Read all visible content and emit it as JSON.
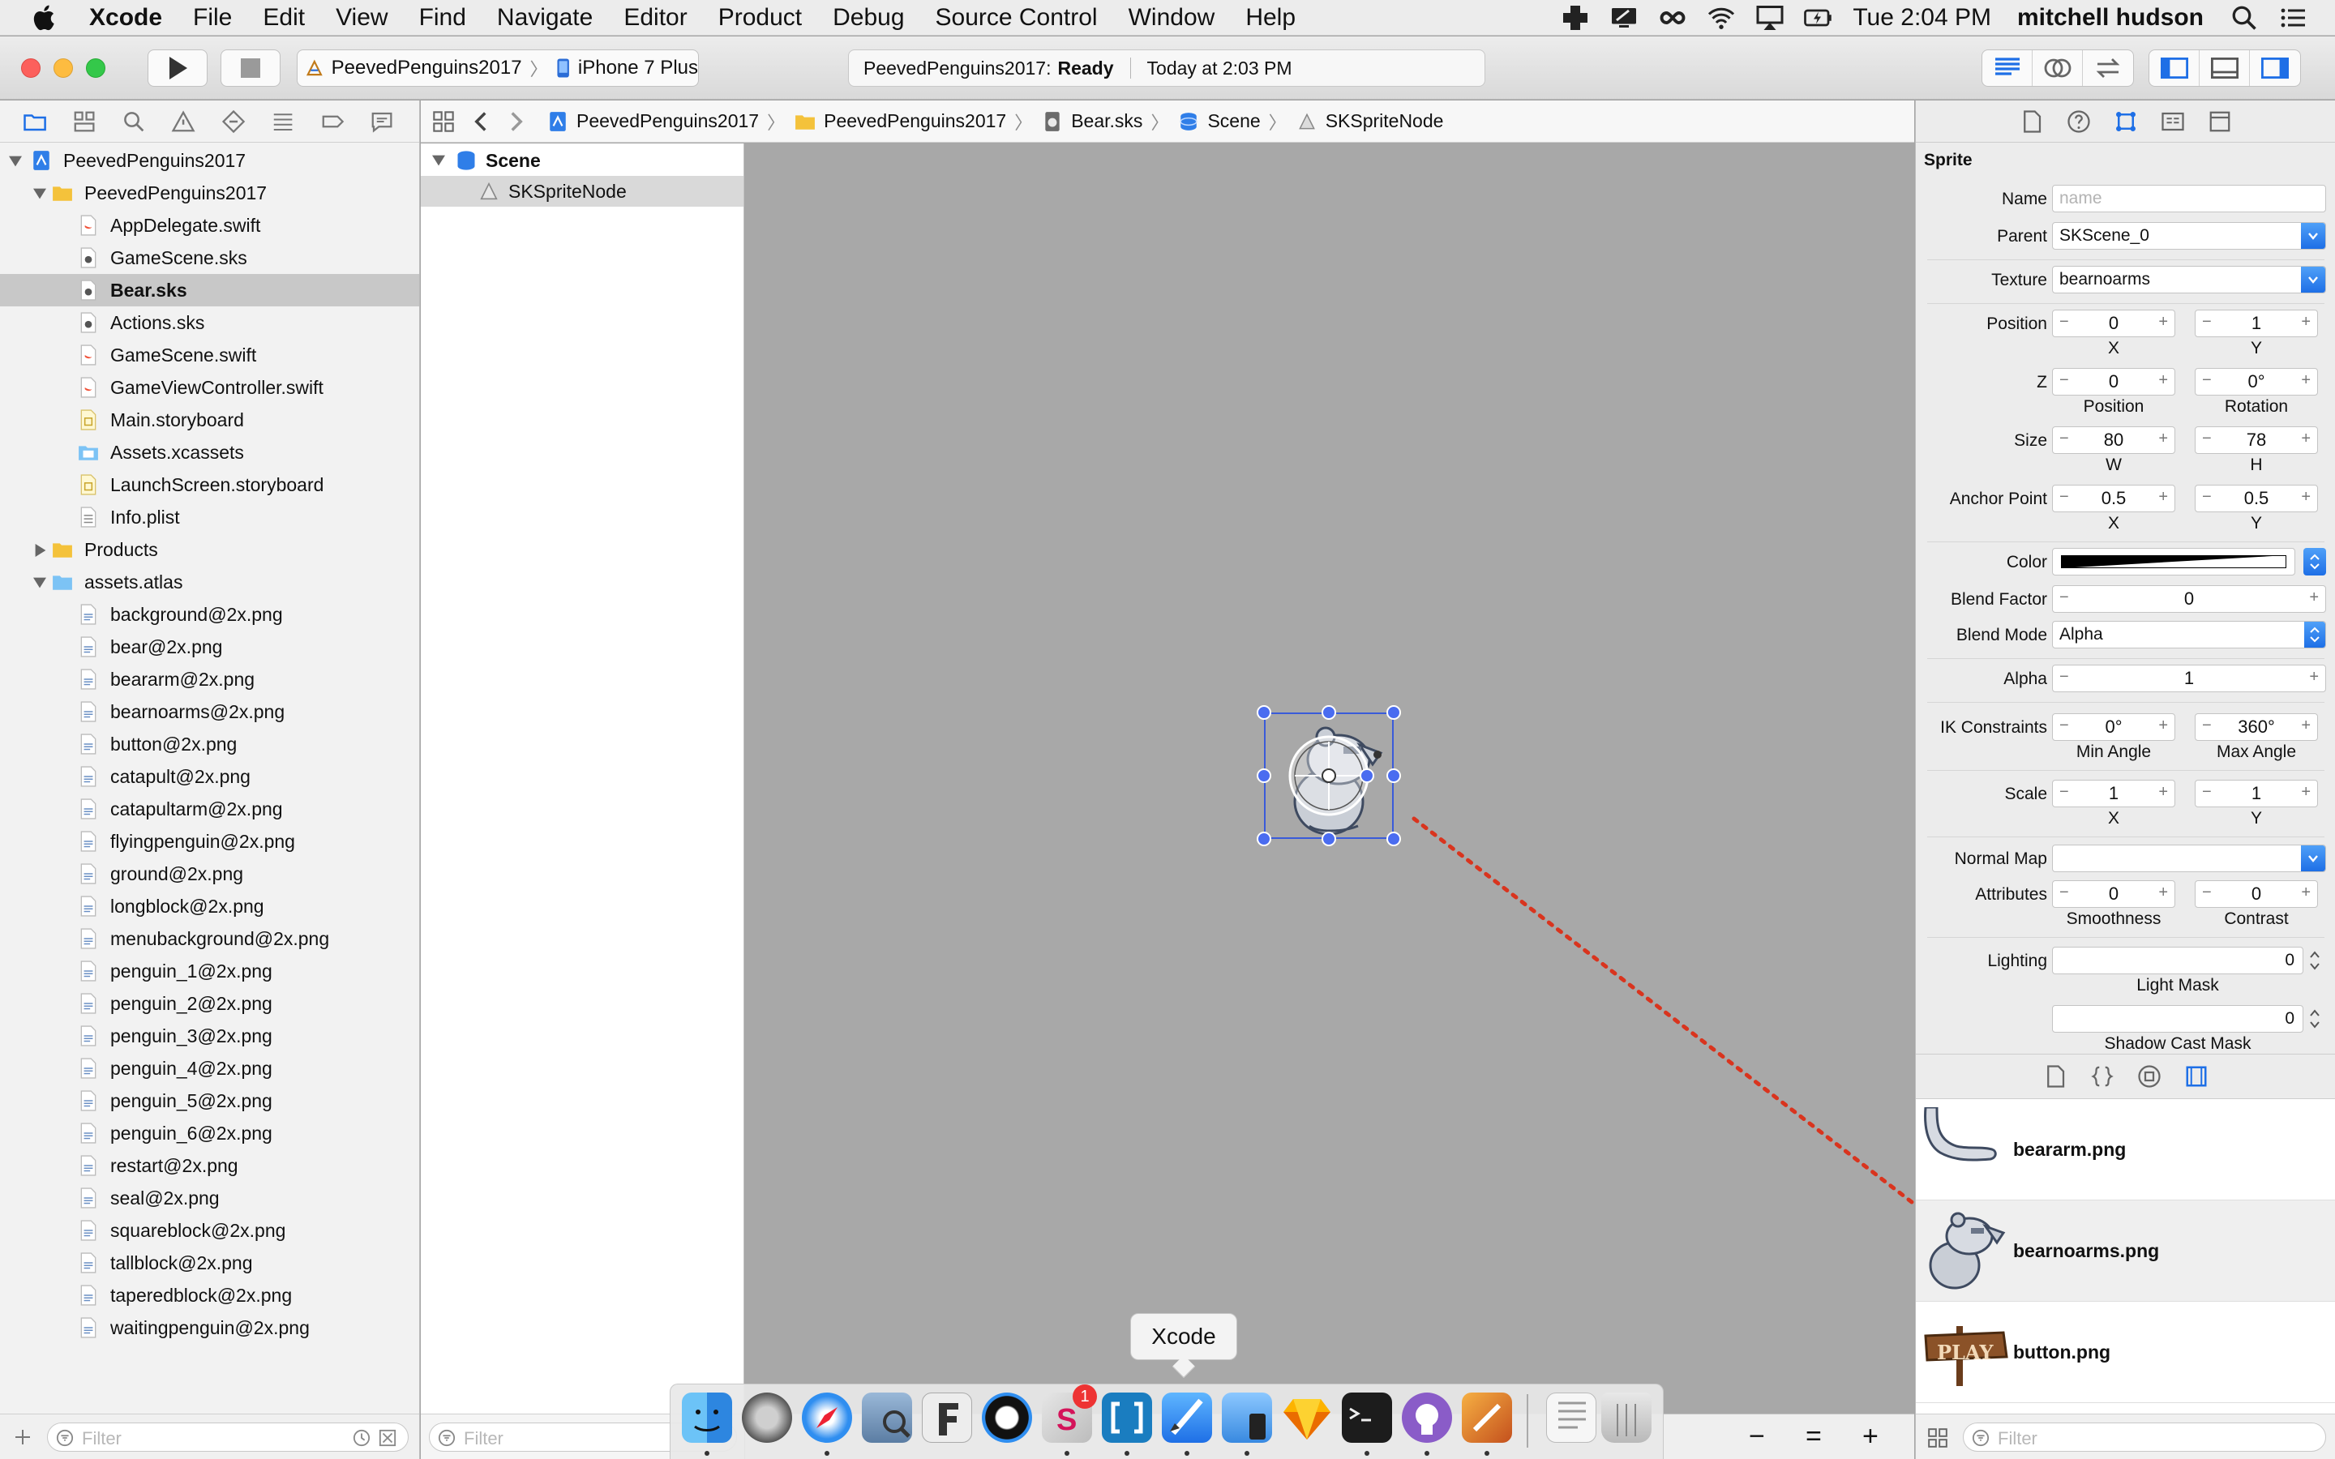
{
  "menubar": {
    "items": [
      "Xcode",
      "File",
      "Edit",
      "View",
      "Find",
      "Navigate",
      "Editor",
      "Product",
      "Debug",
      "Source Control",
      "Window",
      "Help"
    ],
    "clock": "Tue 2:04 PM",
    "user": "mitchell hudson"
  },
  "toolbar": {
    "scheme": "PeevedPenguins2017",
    "device": "iPhone 7 Plus",
    "status_project": "PeevedPenguins2017:",
    "status_state": "Ready",
    "status_time": "Today at 2:03 PM"
  },
  "navigator": {
    "rows": [
      {
        "label": "PeevedPenguins2017",
        "kind": "project",
        "indent": 0,
        "disclosure": "open"
      },
      {
        "label": "PeevedPenguins2017",
        "kind": "folder",
        "indent": 1,
        "disclosure": "open"
      },
      {
        "label": "AppDelegate.swift",
        "kind": "swift",
        "indent": 2
      },
      {
        "label": "GameScene.sks",
        "kind": "sks",
        "indent": 2
      },
      {
        "label": "Bear.sks",
        "kind": "sks",
        "indent": 2,
        "selected": true
      },
      {
        "label": "Actions.sks",
        "kind": "sks",
        "indent": 2
      },
      {
        "label": "GameScene.swift",
        "kind": "swift",
        "indent": 2
      },
      {
        "label": "GameViewController.swift",
        "kind": "swift",
        "indent": 2
      },
      {
        "label": "Main.storyboard",
        "kind": "storyboard",
        "indent": 2
      },
      {
        "label": "Assets.xcassets",
        "kind": "assets",
        "indent": 2
      },
      {
        "label": "LaunchScreen.storyboard",
        "kind": "storyboard",
        "indent": 2
      },
      {
        "label": "Info.plist",
        "kind": "plist",
        "indent": 2
      },
      {
        "label": "Products",
        "kind": "folder",
        "indent": 1,
        "disclosure": "closed"
      },
      {
        "label": "assets.atlas",
        "kind": "atlas",
        "indent": 1,
        "disclosure": "open"
      },
      {
        "label": "background@2x.png",
        "kind": "png",
        "indent": 2
      },
      {
        "label": "bear@2x.png",
        "kind": "png",
        "indent": 2
      },
      {
        "label": "beararm@2x.png",
        "kind": "png",
        "indent": 2
      },
      {
        "label": "bearnoarms@2x.png",
        "kind": "png",
        "indent": 2
      },
      {
        "label": "button@2x.png",
        "kind": "png",
        "indent": 2
      },
      {
        "label": "catapult@2x.png",
        "kind": "png",
        "indent": 2
      },
      {
        "label": "catapultarm@2x.png",
        "kind": "png",
        "indent": 2
      },
      {
        "label": "flyingpenguin@2x.png",
        "kind": "png",
        "indent": 2
      },
      {
        "label": "ground@2x.png",
        "kind": "png",
        "indent": 2
      },
      {
        "label": "longblock@2x.png",
        "kind": "png",
        "indent": 2
      },
      {
        "label": "menubackground@2x.png",
        "kind": "png",
        "indent": 2
      },
      {
        "label": "penguin_1@2x.png",
        "kind": "png",
        "indent": 2
      },
      {
        "label": "penguin_2@2x.png",
        "kind": "png",
        "indent": 2
      },
      {
        "label": "penguin_3@2x.png",
        "kind": "png",
        "indent": 2
      },
      {
        "label": "penguin_4@2x.png",
        "kind": "png",
        "indent": 2
      },
      {
        "label": "penguin_5@2x.png",
        "kind": "png",
        "indent": 2
      },
      {
        "label": "penguin_6@2x.png",
        "kind": "png",
        "indent": 2
      },
      {
        "label": "restart@2x.png",
        "kind": "png",
        "indent": 2
      },
      {
        "label": "seal@2x.png",
        "kind": "png",
        "indent": 2
      },
      {
        "label": "squareblock@2x.png",
        "kind": "png",
        "indent": 2
      },
      {
        "label": "tallblock@2x.png",
        "kind": "png",
        "indent": 2
      },
      {
        "label": "taperedblock@2x.png",
        "kind": "png",
        "indent": 2
      },
      {
        "label": "waitingpenguin@2x.png",
        "kind": "png",
        "indent": 2
      }
    ],
    "filter_placeholder": "Filter"
  },
  "jumpbar": {
    "crumbs": [
      "PeevedPenguins2017",
      "PeevedPenguins2017",
      "Bear.sks",
      "Scene",
      "SKSpriteNode"
    ]
  },
  "outline": {
    "scene": "Scene",
    "node": "SKSpriteNode",
    "filter_placeholder": "Filter"
  },
  "inspector": {
    "section": "Sprite",
    "name_label": "Name",
    "name_placeholder": "name",
    "parent_label": "Parent",
    "parent_value": "SKScene_0",
    "texture_label": "Texture",
    "texture_value": "bearnoarms",
    "position_label": "Position",
    "pos_x": "0",
    "pos_y": "1",
    "x": "X",
    "y": "Y",
    "z_label": "Z",
    "z_value": "0",
    "rotation_value": "0°",
    "z_sub": "Position",
    "rotation_sub": "Rotation",
    "size_label": "Size",
    "size_w": "80",
    "size_h": "78",
    "w": "W",
    "h": "H",
    "anchor_label": "Anchor Point",
    "anchor_x": "0.5",
    "anchor_y": "0.5",
    "color_label": "Color",
    "blend_factor_label": "Blend Factor",
    "blend_factor": "0",
    "blend_mode_label": "Blend Mode",
    "blend_mode": "Alpha",
    "alpha_label": "Alpha",
    "alpha": "1",
    "ik_label": "IK Constraints",
    "ik_min": "0°",
    "ik_max": "360°",
    "ik_min_sub": "Min Angle",
    "ik_max_sub": "Max Angle",
    "scale_label": "Scale",
    "scale_x": "1",
    "scale_y": "1",
    "normal_map_label": "Normal Map",
    "attributes_label": "Attributes",
    "smoothness": "0",
    "contrast": "0",
    "smoothness_sub": "Smoothness",
    "contrast_sub": "Contrast",
    "lighting_label": "Lighting",
    "light_mask": "0",
    "light_mask_sub": "Light Mask",
    "shadow_cast": "0",
    "shadow_cast_sub": "Shadow Cast Mask"
  },
  "library": {
    "items": [
      "beararm.png",
      "bearnoarms.png",
      "button.png"
    ],
    "play_text": "PLAY",
    "filter_placeholder": "Filter"
  },
  "canvasbar": {
    "minus": "−",
    "equals": "=",
    "plus": "+"
  },
  "dock": {
    "tooltip": "Xcode",
    "badge": "1"
  },
  "colors": {
    "selection_handle": "#3a5bd9",
    "drag_line": "#d9341e",
    "accent": "#1e6fe6"
  }
}
